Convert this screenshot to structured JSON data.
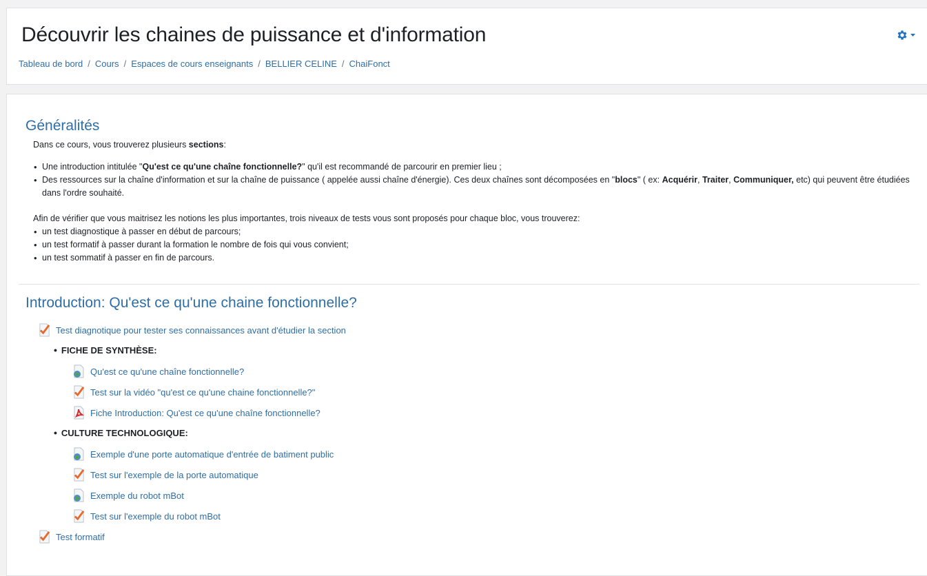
{
  "header": {
    "title": "Découvrir les chaines de puissance et d'information",
    "breadcrumb": [
      "Tableau de bord",
      "Cours",
      "Espaces de cours enseignants",
      "BELLIER CELINE",
      "ChaiFonct"
    ],
    "settings_icon": "gear-icon"
  },
  "generalites": {
    "title": "Généralités",
    "intro_text": "Dans ce cours, vous trouverez plusieurs ",
    "intro_bold": "sections",
    "intro_end": ":",
    "bullet1_a": "Une introduction intitulée \"",
    "bullet1_bold": "Qu'est ce qu'une chaîne fonctionnelle?",
    "bullet1_b": "\" qu'il est recommandé de parcourir en premier lieu ;",
    "bullet2_a": "Des ressources sur la chaîne d'information et sur la chaîne de puissance ( appelée aussi chaîne d'énergie). Ces deux chaînes sont décomposées en \"",
    "bullet2_bold1": "blocs",
    "bullet2_b": "\" ( ex: ",
    "bullet2_bold2": "Acquérir",
    "bullet2_c": ", ",
    "bullet2_bold3": "Traiter",
    "bullet2_d": ", ",
    "bullet2_bold4": "Communiquer,",
    "bullet2_e": " etc) qui peuvent être étudiées dans l'ordre souhaité.",
    "tests_intro": "Afin de vérifier que vous maitrisez les notions les plus importantes, trois niveaux de tests vous sont proposés pour chaque bloc, vous trouverez:",
    "tests": [
      "un test diagnostique à passer en début de parcours;",
      "un test formatif à passer durant la formation le nombre de fois qui vous convient;",
      "un test sommatif à passer en fin de parcours."
    ]
  },
  "introduction": {
    "title": "Introduction: Qu'est ce qu'une chaine fonctionnelle?",
    "test_diag": "Test diagnotique pour tester ses connaissances avant d'étudier la section",
    "fiche_heading": "FICHE DE SYNTHÈSE:",
    "fiche_items": [
      "Qu'est ce qu'une chaîne fonctionnelle?",
      "Test sur la vidéo \"qu'est ce qu'une chaine fonctionnelle?\"",
      "Fiche Introduction: Qu'est ce qu'une chaîne fonctionnelle?"
    ],
    "culture_heading": "CULTURE TECHNOLOGIQUE:",
    "culture_items": [
      "Exemple d'une porte automatique d'entrée de batiment public",
      "Test sur l'exemple de la porte automatique",
      "Exemple du robot mBot",
      "Test sur l'exemple du robot mBot"
    ],
    "test_formatif": "Test formatif"
  },
  "colors": {
    "link": "#2f6ea5",
    "quiz_check": "#e8692c",
    "pdf_red": "#d92b2b",
    "url_green": "#5aa33a"
  }
}
